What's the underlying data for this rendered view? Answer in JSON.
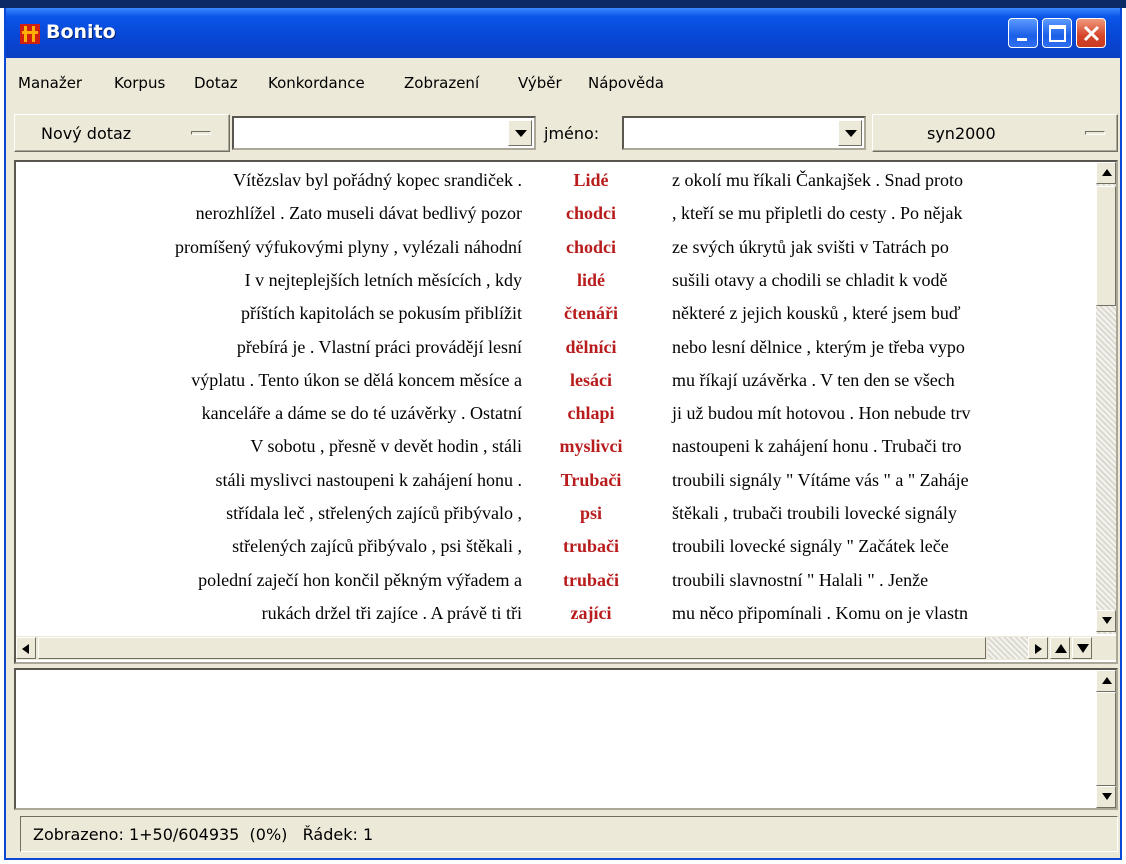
{
  "window": {
    "title": "Bonito"
  },
  "menu": [
    "Manažer",
    "Korpus",
    "Dotaz",
    "Konkordance",
    "Zobrazení",
    "Výběr",
    "Nápověda"
  ],
  "toolbar": {
    "new_query_label": "Nový dotaz",
    "query_value": "",
    "name_label": "jméno:",
    "name_value": "",
    "corpus_label": "syn2000"
  },
  "concordance": [
    {
      "left": "Vítězslav byl pořádný kopec srandiček .",
      "kwic": "Lidé",
      "right": "z okolí mu říkali Čankajšek . Snad proto"
    },
    {
      "left": "nerozhlížel . Zato museli dávat bedlivý pozor",
      "kwic": "chodci",
      "right": ", kteří se mu připletli do cesty . Po nějak"
    },
    {
      "left": "promíšený výfukovými plyny , vylézali náhodní",
      "kwic": "chodci",
      "right": "ze svých úkrytů jak svišti v Tatrách po"
    },
    {
      "left": "I v nejteplejších letních měsících , kdy",
      "kwic": "lidé",
      "right": "sušili otavy a chodili se chladit k vodě"
    },
    {
      "left": "příštích kapitolách se pokusím přiblížit",
      "kwic": "čtenáři",
      "right": "některé z jejich kousků , které jsem buď"
    },
    {
      "left": "přebírá je . Vlastní práci provádějí lesní",
      "kwic": "dělníci",
      "right": "nebo lesní dělnice , kterým je třeba vypo"
    },
    {
      "left": "výplatu . Tento úkon se dělá koncem měsíce a",
      "kwic": "lesáci",
      "right": "mu říkají uzávěrka . V ten den se všech"
    },
    {
      "left": "kanceláře a dáme se do té uzávěrky . Ostatní",
      "kwic": "chlapi",
      "right": "ji už budou mít hotovou . Hon nebude trv"
    },
    {
      "left": "V sobotu , přesně v devět hodin , stáli",
      "kwic": "myslivci",
      "right": "nastoupeni k zahájení honu . Trubači tro"
    },
    {
      "left": "stáli myslivci nastoupeni k zahájení honu .",
      "kwic": "Trubači",
      "right": "troubili signály \" Vítáme vás \" a \" Zaháje"
    },
    {
      "left": "střídala leč , střelených zajíců přibývalo ,",
      "kwic": "psi",
      "right": "štěkali , trubači troubili lovecké signály"
    },
    {
      "left": "střelených zajíců přibývalo , psi štěkali ,",
      "kwic": "trubači",
      "right": "troubili lovecké signály \" Začátek leče"
    },
    {
      "left": "polední zaječí hon končil pěkným výřadem a",
      "kwic": "trubači",
      "right": "troubili slavnostní \" Halali \" . Jenže"
    },
    {
      "left": "rukách držel tři zajíce . A právě ti tři",
      "kwic": "zajíci",
      "right": "mu něco připomínali . Komu on je vlastn"
    }
  ],
  "status": "Zobrazeno: 1+50/604935  (0%)   Řádek: 1"
}
